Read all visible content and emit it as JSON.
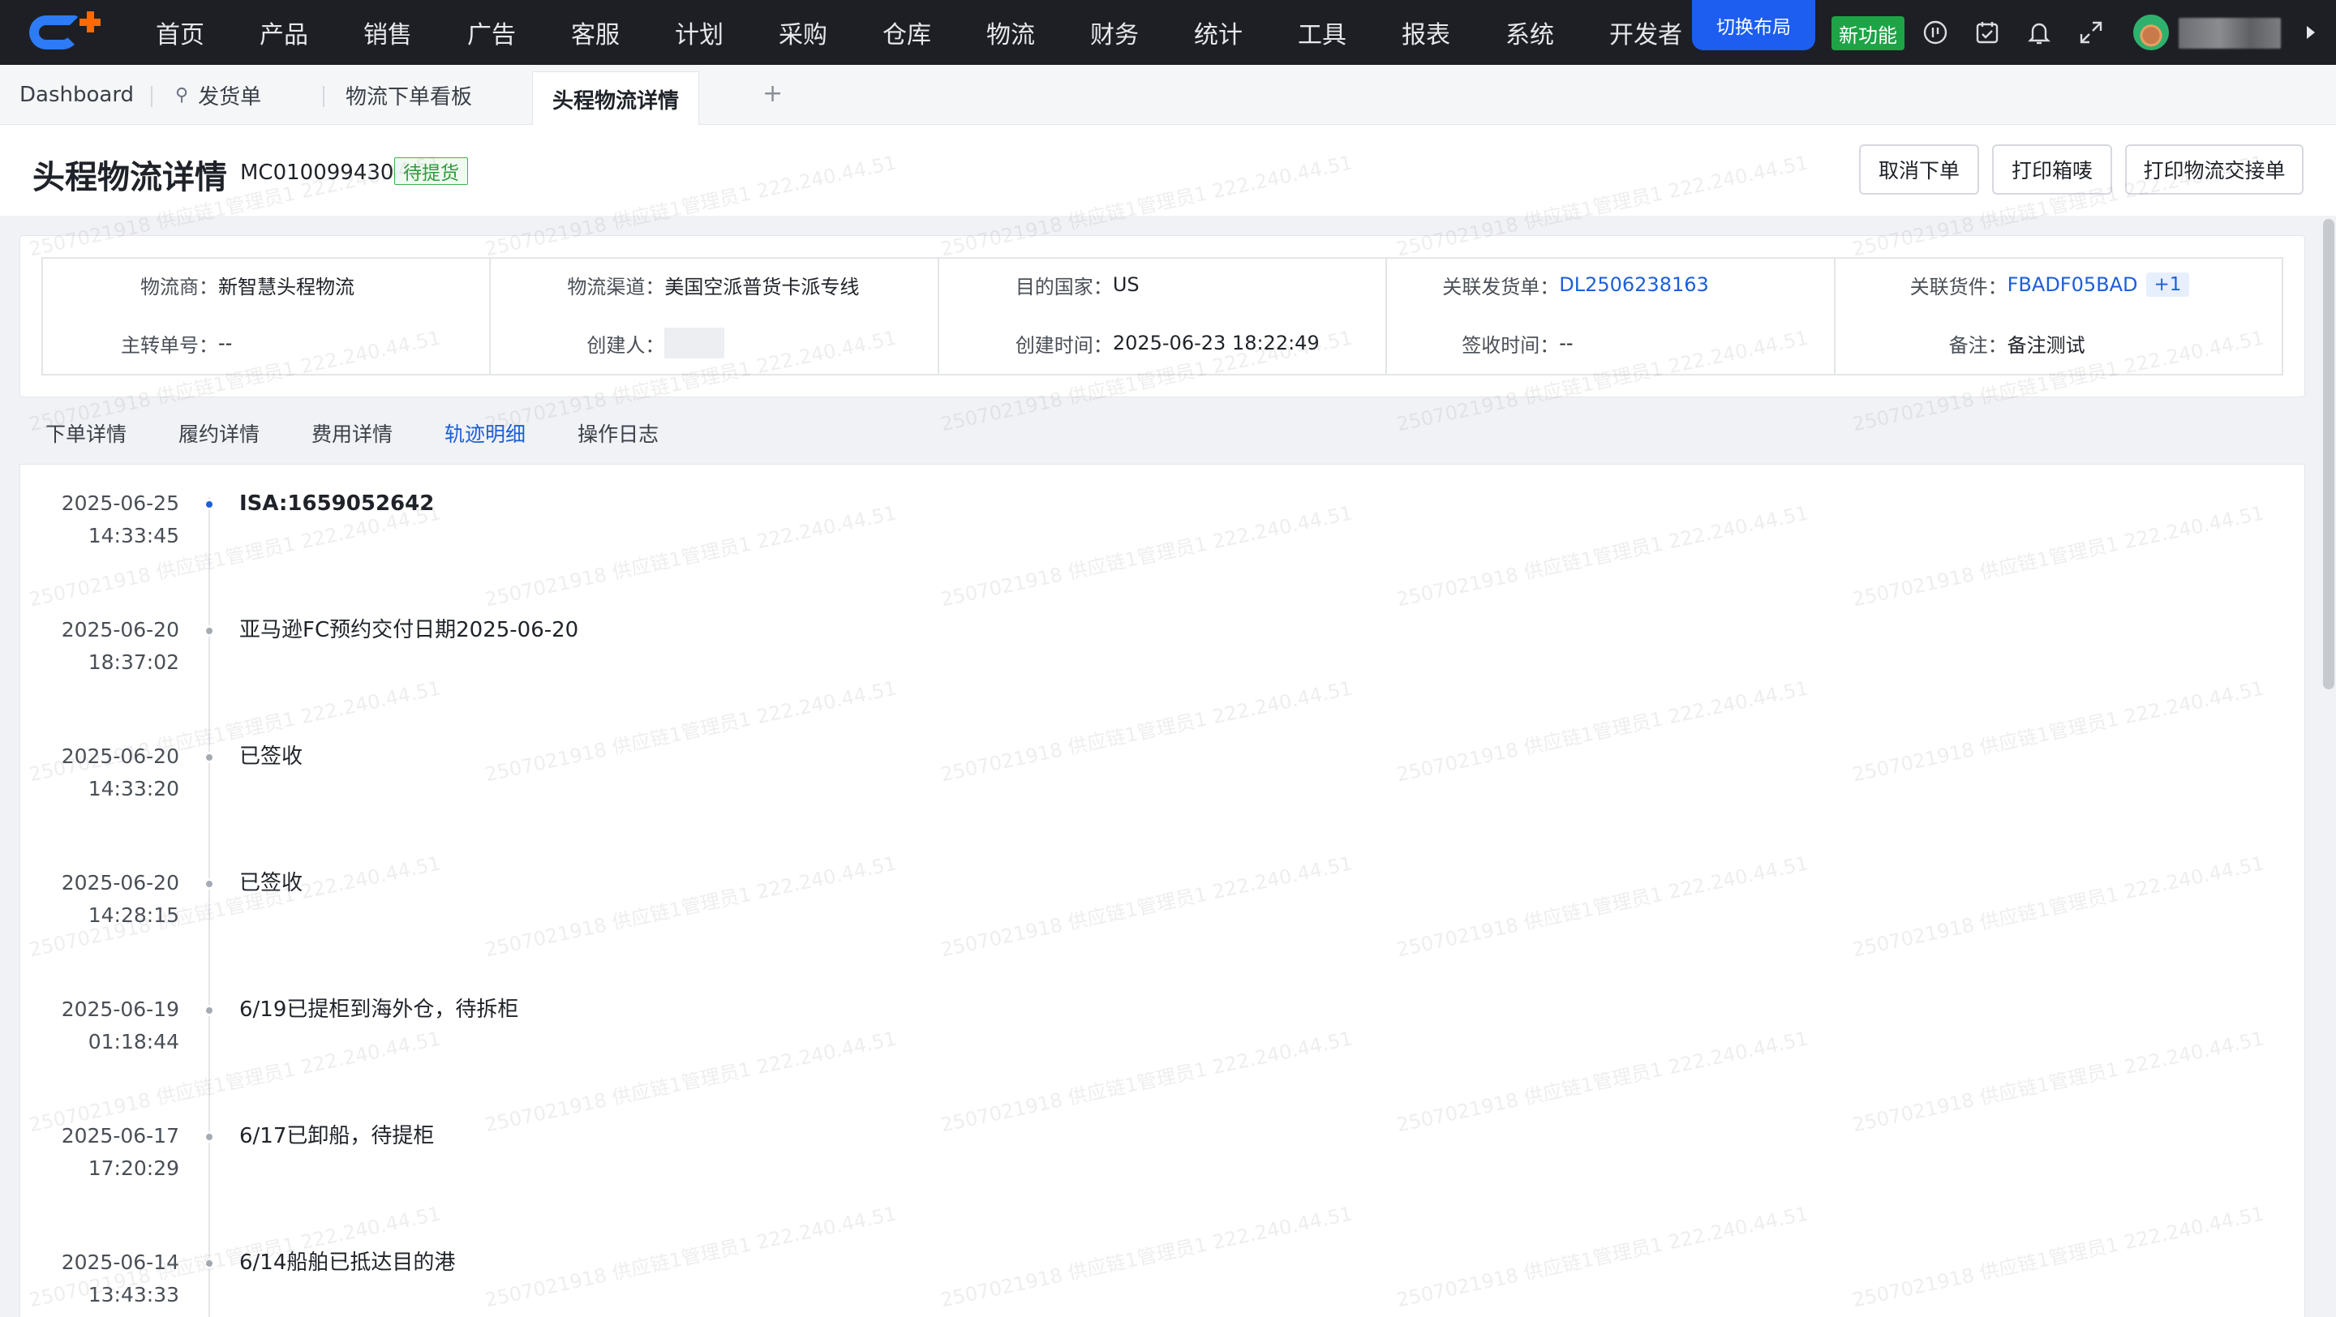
{
  "topnav": {
    "menu": [
      "首页",
      "产品",
      "销售",
      "广告",
      "客服",
      "计划",
      "采购",
      "仓库",
      "物流",
      "财务",
      "统计",
      "工具",
      "报表",
      "系统",
      "开发者"
    ],
    "switch_layout": "切换布局",
    "new_feature": "新功能"
  },
  "tabs": [
    {
      "label": "Dashboard"
    },
    {
      "label": "发货单"
    },
    {
      "label": "物流下单看板"
    },
    {
      "label": "头程物流详情"
    }
  ],
  "tab_add": "+",
  "header": {
    "title": "头程物流详情",
    "order_no": "MC010099430",
    "status": "待提货",
    "buttons": [
      "取消下单",
      "打印箱唛",
      "打印物流交接单"
    ]
  },
  "info": {
    "col1": {
      "l1": "物流商：",
      "v1": "新智慧头程物流",
      "l2": "主转单号：",
      "v2": "--"
    },
    "col2": {
      "l1": "物流渠道：",
      "v1": "美国空派普货卡派专线",
      "l2": "创建人："
    },
    "col3": {
      "l1": "目的国家：",
      "v1": "US",
      "l2": "创建时间：",
      "v2": "2025-06-23 18:22:49"
    },
    "col4": {
      "l1": "关联发货单：",
      "v1": "DL2506238163",
      "l2": "签收时间：",
      "v2": "--"
    },
    "col5": {
      "l1": "关联货件：",
      "v1": "FBADF05BAD",
      "badge": "+1",
      "l2": "备注：",
      "v2": "备注测试"
    }
  },
  "subtabs": [
    "下单详情",
    "履约详情",
    "费用详情",
    "轨迹明细",
    "操作日志"
  ],
  "timeline": [
    {
      "date": "2025-06-25",
      "time": "14:33:45",
      "text": "ISA:1659052642"
    },
    {
      "date": "2025-06-20",
      "time": "18:37:02",
      "text": "亚马逊FC预约交付日期2025-06-20"
    },
    {
      "date": "2025-06-20",
      "time": "14:33:20",
      "text": "已签收"
    },
    {
      "date": "2025-06-20",
      "time": "14:28:15",
      "text": "已签收"
    },
    {
      "date": "2025-06-19",
      "time": "01:18:44",
      "text": "6/19已提柜到海外仓，待拆柜"
    },
    {
      "date": "2025-06-17",
      "time": "17:20:29",
      "text": "6/17已卸船，待提柜"
    },
    {
      "date": "2025-06-14",
      "time": "13:43:33",
      "text": "6/14船舶已抵达目的港"
    }
  ],
  "watermark": "2507021918 供应链1管理员1 222.240.44.51",
  "colors": {
    "accent": "#1b5fd9",
    "nav_bg": "#1e1f24",
    "switch_btn": "#1d5df0",
    "new_feature": "#1fa347",
    "status_green": "#2a9d3c"
  },
  "icons": [
    "clock-icon",
    "calendar-check-icon",
    "bell-icon",
    "expand-icon",
    "pin-icon",
    "chevron-right-icon"
  ]
}
